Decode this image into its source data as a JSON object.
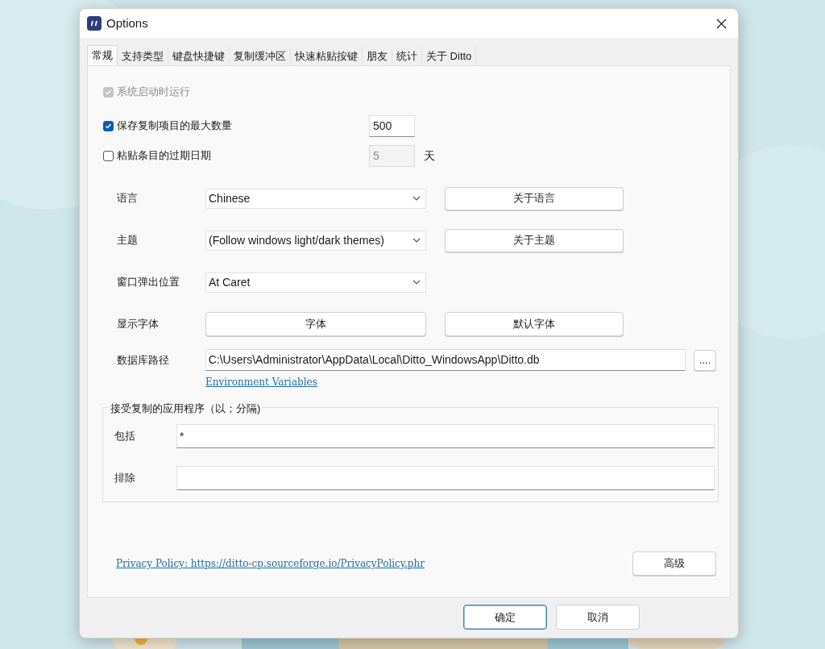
{
  "window": {
    "title": "Options"
  },
  "tabs": [
    {
      "label": "常规",
      "selected": true
    },
    {
      "label": "支持类型",
      "selected": false
    },
    {
      "label": "键盘快捷键",
      "selected": false
    },
    {
      "label": "复制缓冲区",
      "selected": false
    },
    {
      "label": "快速粘贴按键",
      "selected": false
    },
    {
      "label": "朋友",
      "selected": false
    },
    {
      "label": "统计",
      "selected": false
    },
    {
      "label": "关于 Ditto",
      "selected": false
    }
  ],
  "checks": [
    {
      "label": "系统启动时运行",
      "checked": true,
      "disabled": true
    },
    {
      "label": "保存复制项目的最大数量",
      "checked": true,
      "disabled": false,
      "value": "500",
      "field_disabled": false
    },
    {
      "label": "粘贴条目的过期日期",
      "checked": false,
      "disabled": false,
      "value": "5",
      "field_disabled": true,
      "unit": "天"
    }
  ],
  "settings": [
    {
      "kind": "select",
      "label": "语言",
      "value": "Chinese",
      "button": "关于语言"
    },
    {
      "kind": "select",
      "label": "主题",
      "value": "(Follow windows light/dark themes)",
      "button": "关于主题"
    },
    {
      "kind": "select",
      "label": "窗口弹出位置",
      "value": "At Caret"
    },
    {
      "kind": "buttons",
      "label": "显示字体",
      "button_1": "字体",
      "button_2": "默认字体"
    },
    {
      "kind": "path",
      "label": "数据库路径",
      "value": "C:\\Users\\Administrator\\AppData\\Local\\Ditto_WindowsApp\\Ditto.db",
      "button": "....",
      "link": "Environment Variables"
    }
  ],
  "apps_group": {
    "title": "接受复制的应用程序（以；分隔)",
    "fields": [
      {
        "label": "包括",
        "value": "*"
      },
      {
        "label": "排除"
      }
    ]
  },
  "privacy_link": "Privacy Policy: https://ditto-cp.sourceforge.io/PrivacyPolicy.phr",
  "advanced_button": "高级",
  "buttons": [
    {
      "label": "确定",
      "default": true
    },
    {
      "label": "取消",
      "default": false
    }
  ]
}
